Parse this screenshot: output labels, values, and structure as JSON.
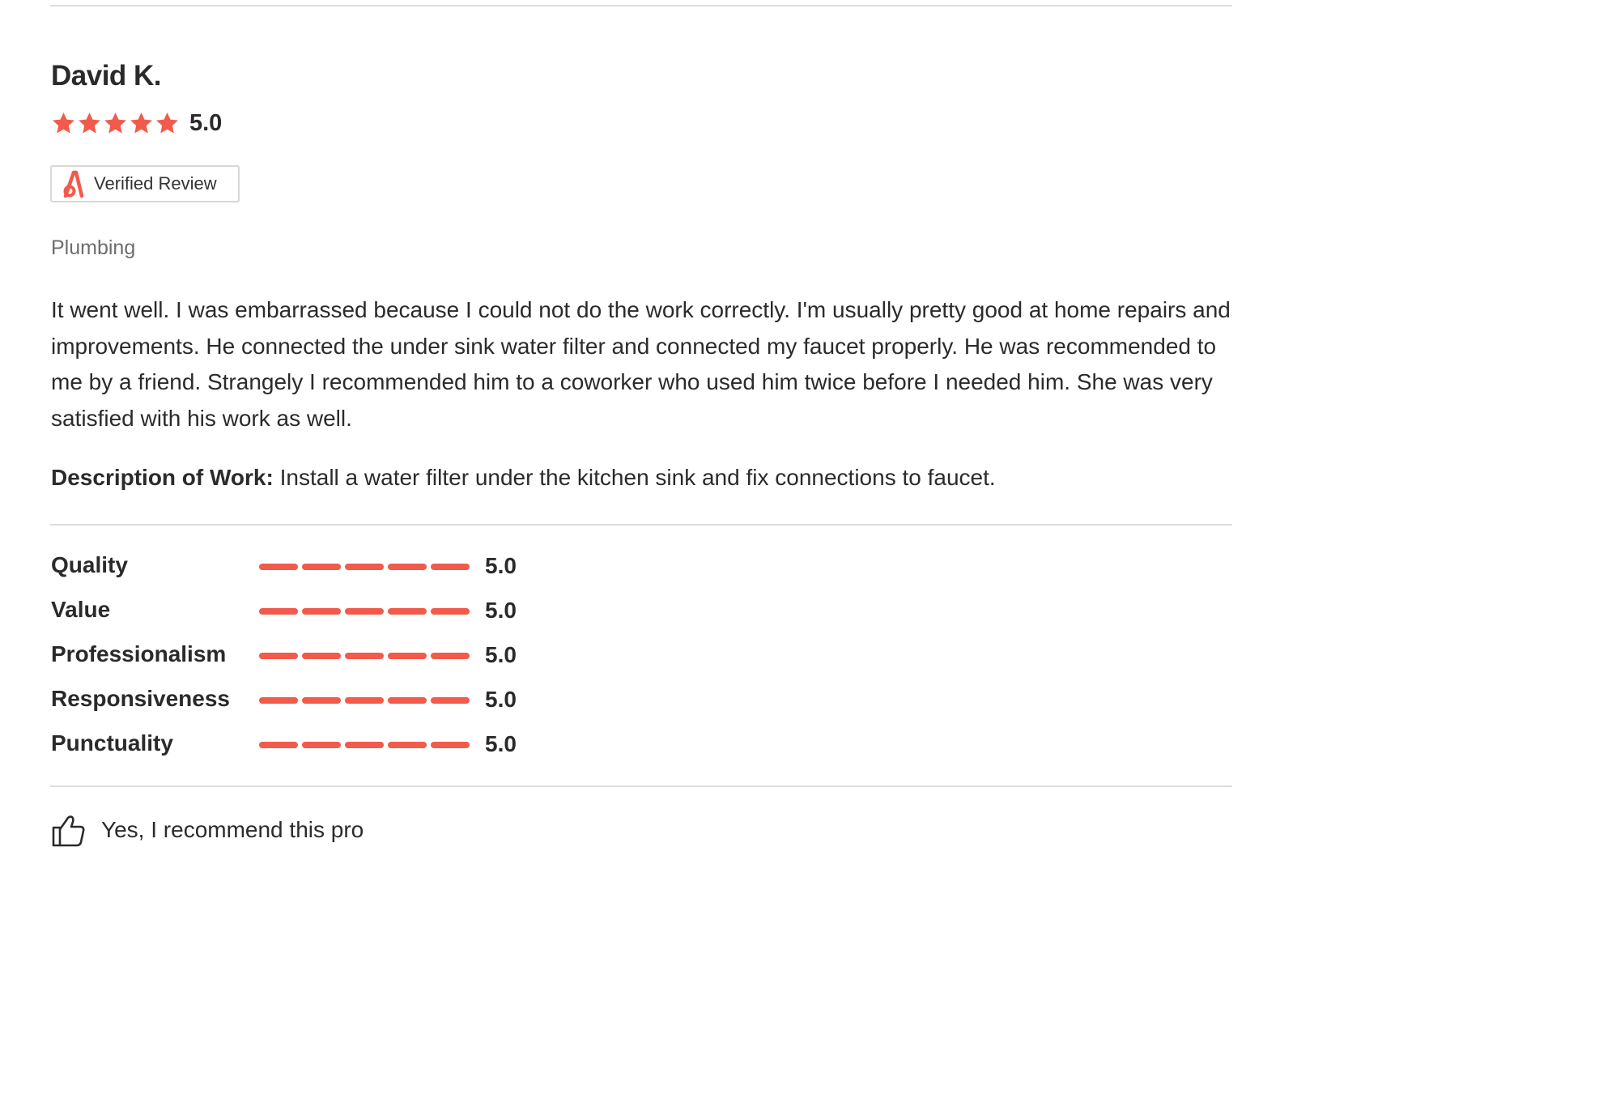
{
  "review": {
    "reviewer_name": "David K.",
    "overall_rating": "5.0",
    "overall_stars": 5,
    "star_color": "#f25a4c",
    "verified_label": "Verified Review",
    "category": "Plumbing",
    "text": "It went well. I was embarrassed because I could not do the work correctly. I'm usually pretty good at home repairs and improvements. He connected the under sink water filter and connected my faucet properly. He was recommended to me by a friend. Strangely I recommended him to a coworker who used him twice before I needed him. She was very satisfied with his work as well.",
    "work_label": "Description of Work:",
    "work_text": "Install a water filter under the kitchen sink and fix connections to faucet."
  },
  "ratings": [
    {
      "label": "Quality",
      "value": "5.0",
      "level": 5
    },
    {
      "label": "Value",
      "value": "5.0",
      "level": 5
    },
    {
      "label": "Professionalism",
      "value": "5.0",
      "level": 5
    },
    {
      "label": "Responsiveness",
      "value": "5.0",
      "level": 5
    },
    {
      "label": "Punctuality",
      "value": "5.0",
      "level": 5
    }
  ],
  "recommend": {
    "text": "Yes, I recommend this pro",
    "icon": "thumbs-up-icon"
  },
  "colors": {
    "accent": "#f25a4c",
    "divider": "#dcdcdc",
    "muted_text": "#6d6d6d"
  }
}
